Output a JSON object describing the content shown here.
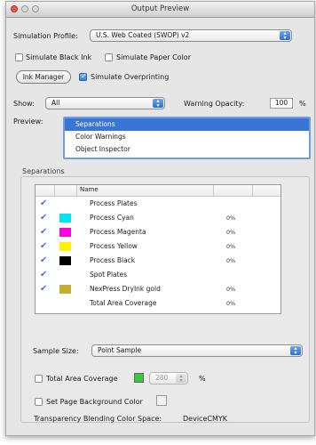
{
  "window": {
    "title": "Output Preview"
  },
  "simulation": {
    "label": "Simulation Profile:",
    "value": "U.S. Web Coated (SWOP) v2",
    "black_ink_label": "Simulate Black Ink",
    "paper_color_label": "Simulate Paper Color",
    "ink_manager_label": "Ink Manager",
    "overprinting_label": "Simulate Overprinting",
    "black_ink_checked": false,
    "paper_color_checked": false,
    "overprinting_checked": true
  },
  "show": {
    "label": "Show:",
    "value": "All",
    "warning_opacity_label": "Warning Opacity:",
    "warning_opacity_value": "100",
    "warning_opacity_unit": "%"
  },
  "preview": {
    "label": "Preview:",
    "items": [
      "Separations",
      "Color Warnings",
      "Object Inspector"
    ],
    "selected_index": 0
  },
  "separations": {
    "group_label": "Separations",
    "column_name": "Name",
    "rows": [
      {
        "checked": true,
        "swatch": "",
        "name": "Process Plates",
        "pct": ""
      },
      {
        "checked": true,
        "swatch": "#00e5f0",
        "name": "Process Cyan",
        "pct": "0%"
      },
      {
        "checked": true,
        "swatch": "#ff00dc",
        "name": "Process Magenta",
        "pct": "0%"
      },
      {
        "checked": true,
        "swatch": "#fff200",
        "name": "Process Yellow",
        "pct": "0%"
      },
      {
        "checked": true,
        "swatch": "#000000",
        "name": "Process Black",
        "pct": "0%"
      },
      {
        "checked": true,
        "swatch": "",
        "name": "Spot Plates",
        "pct": ""
      },
      {
        "checked": true,
        "swatch": "#c2ae2f",
        "name": "NexPress DryInk gold",
        "pct": "0%"
      },
      {
        "checked": false,
        "swatch": "",
        "name": "Total Area Coverage",
        "pct": "0%"
      }
    ]
  },
  "sample": {
    "label": "Sample Size:",
    "value": "Point Sample"
  },
  "total_area": {
    "label": "Total Area Coverage",
    "checked": false,
    "color": "#3cc83c",
    "value": "280",
    "unit": "%"
  },
  "page_bg": {
    "label": "Set Page Background Color",
    "checked": false
  },
  "transparency": {
    "label": "Transparency Blending Color Space:",
    "value": "DeviceCMYK"
  }
}
